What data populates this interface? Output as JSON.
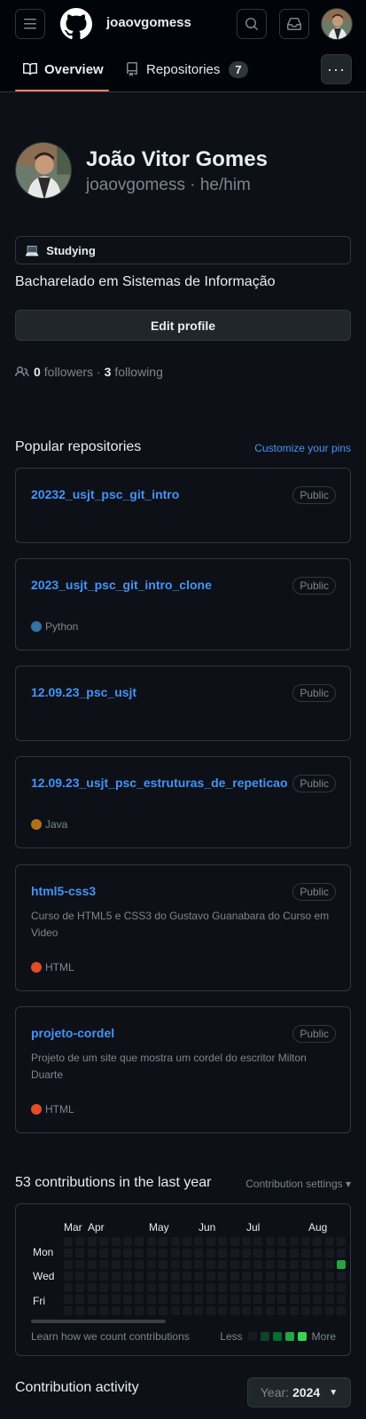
{
  "header": {
    "username": "joaovgomess",
    "tabs": [
      {
        "label": "Overview",
        "active": true
      },
      {
        "label": "Repositories",
        "count": "7"
      }
    ],
    "more_label": "···"
  },
  "profile": {
    "name": "João Vitor Gomes",
    "login": "joaovgomess · he/him",
    "status_emoji": "💻",
    "status_text": "Studying",
    "bio": "Bacharelado em Sistemas de Informação",
    "edit_label": "Edit profile",
    "followers_count": "0",
    "followers_label": "followers ·",
    "following_count": "3",
    "following_label": "following"
  },
  "popular": {
    "title": "Popular repositories",
    "customize_label": "Customize your pins",
    "repos": [
      {
        "name": "20232_usjt_psc_git_intro",
        "visibility": "Public",
        "description": "",
        "language": "",
        "color": ""
      },
      {
        "name": "2023_usjt_psc_git_intro_clone",
        "visibility": "Public",
        "description": "",
        "language": "Python",
        "color": "#3572a5"
      },
      {
        "name": "12.09.23_psc_usjt",
        "visibility": "Public",
        "description": "",
        "language": "",
        "color": ""
      },
      {
        "name": "12.09.23_usjt_psc_estruturas_de_repeticao",
        "visibility": "Public",
        "description": "",
        "language": "Java",
        "color": "#b07219"
      },
      {
        "name": "html5-css3",
        "visibility": "Public",
        "description": "Curso de HTML5 e CSS3 do Gustavo Guanabara do Curso em Video",
        "language": "HTML",
        "color": "#e34c26"
      },
      {
        "name": "projeto-cordel",
        "visibility": "Public",
        "description": "Projeto de um site que mostra um cordel do escritor Milton Duarte",
        "language": "HTML",
        "color": "#e34c26"
      }
    ]
  },
  "contributions": {
    "title": "53 contributions in the last year",
    "settings_label": "Contribution settings ▾",
    "months": [
      "Mar",
      "Apr",
      "May",
      "Jun",
      "Jul",
      "Aug"
    ],
    "days": [
      "Mon",
      "Wed",
      "Fri"
    ],
    "learn_label": "Learn how we count contributions",
    "less_label": "Less",
    "more_label": "More",
    "level_colors": [
      "#161b22",
      "#0e4429",
      "#006d32",
      "#26a641",
      "#39d353"
    ]
  },
  "activity": {
    "title": "Contribution activity",
    "year_prefix": "Year:",
    "year": "2024"
  }
}
